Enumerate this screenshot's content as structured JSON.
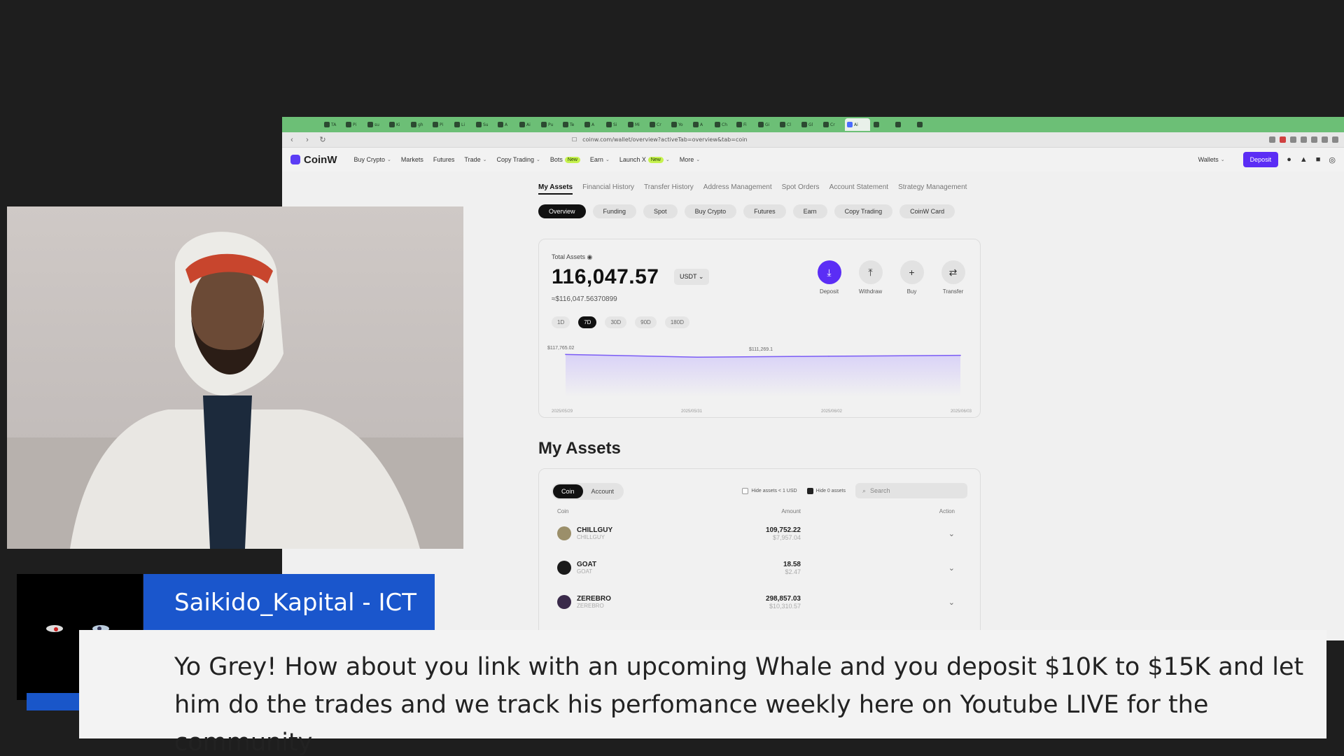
{
  "browser": {
    "tabs": [
      "TA",
      "Pi",
      "su",
      "Ki",
      "gh",
      "Pi",
      "Li",
      "Su",
      "A",
      "Ai",
      "Pu",
      "Te",
      "A",
      "Si",
      "Mi",
      "Cr",
      "Yo",
      "A",
      "Ch",
      "Fi",
      "Gi",
      "Cl",
      "Gl",
      "Cr",
      "Ai",
      "",
      "",
      ""
    ],
    "url": "coinw.com/wallet/overview?activeTab=overview&tab=coin"
  },
  "site": {
    "brand": "CoinW",
    "nav": [
      {
        "label": "Buy Crypto",
        "chevron": true,
        "new": false
      },
      {
        "label": "Markets",
        "chevron": false,
        "new": false
      },
      {
        "label": "Futures",
        "chevron": false,
        "new": false
      },
      {
        "label": "Trade",
        "chevron": true,
        "new": false
      },
      {
        "label": "Copy Trading",
        "chevron": true,
        "new": false
      },
      {
        "label": "Bots",
        "chevron": false,
        "new": true
      },
      {
        "label": "Earn",
        "chevron": true,
        "new": false
      },
      {
        "label": "Launch X",
        "chevron": true,
        "new": true
      },
      {
        "label": "More",
        "chevron": true,
        "new": false
      }
    ],
    "new_badge": "New",
    "wallets_label": "Wallets",
    "deposit_label": "Deposit"
  },
  "subnav": [
    "My Assets",
    "Financial History",
    "Transfer History",
    "Address Management",
    "Spot Orders",
    "Account Statement",
    "Strategy Management"
  ],
  "pills": [
    "Overview",
    "Funding",
    "Spot",
    "Buy Crypto",
    "Futures",
    "Earn",
    "Copy Trading",
    "CoinW Card"
  ],
  "total": {
    "label": "Total Assets",
    "value": "116,047.57",
    "currency": "USDT",
    "usd_equiv": "≈$116,047.56370899",
    "periods": [
      "1D",
      "7D",
      "30D",
      "90D",
      "180D"
    ],
    "active_period": "7D"
  },
  "actions": [
    {
      "label": "Deposit",
      "icon": "download-icon",
      "glyph": "⤓"
    },
    {
      "label": "Withdraw",
      "icon": "upload-icon",
      "glyph": "⤒"
    },
    {
      "label": "Buy",
      "icon": "plus-icon",
      "glyph": "+"
    },
    {
      "label": "Transfer",
      "icon": "transfer-icon",
      "glyph": "⇄"
    }
  ],
  "chart_data": {
    "type": "area",
    "x": [
      "2025/05/29",
      "2025/05/31",
      "2025/06/02",
      "2025/06/03"
    ],
    "values": [
      117765.02,
      111269.1,
      113500,
      115600
    ],
    "annotations": [
      "$117,765.02",
      "$111,269.1"
    ],
    "xlabels": [
      "2025/05/29",
      "2025/05/31",
      "2025/06/02",
      "2025/06/03"
    ],
    "ylim": [
      0,
      130000
    ],
    "color": "#7b5cf5"
  },
  "myassets": {
    "title": "My Assets",
    "toggle": [
      "Coin",
      "Account"
    ],
    "hide_small": "Hide assets < 1 USD",
    "hide_zero": "Hide 0 assets",
    "search_placeholder": "Search",
    "headers": {
      "coin": "Coin",
      "amount": "Amount",
      "action": "Action"
    },
    "rows": [
      {
        "symbol": "CHILLGUY",
        "name": "CHILLGUY",
        "amount": "109,752.22",
        "usd": "$7,957.04",
        "color": "#9b8f6a"
      },
      {
        "symbol": "GOAT",
        "name": "GOAT",
        "amount": "18.58",
        "usd": "$2.47",
        "color": "#1a1a1a"
      },
      {
        "symbol": "ZEREBRO",
        "name": "ZEREBRO",
        "amount": "298,857.03",
        "usd": "$10,310.57",
        "color": "#3a2a4a"
      }
    ]
  },
  "overlay": {
    "username": "Saikido_Kapital - ICT",
    "message": "Yo Grey! How about you link with an upcoming Whale and you deposit $10K to $15K and let him do the trades and we track his perfomance weekly here on Youtube LIVE for the community"
  }
}
